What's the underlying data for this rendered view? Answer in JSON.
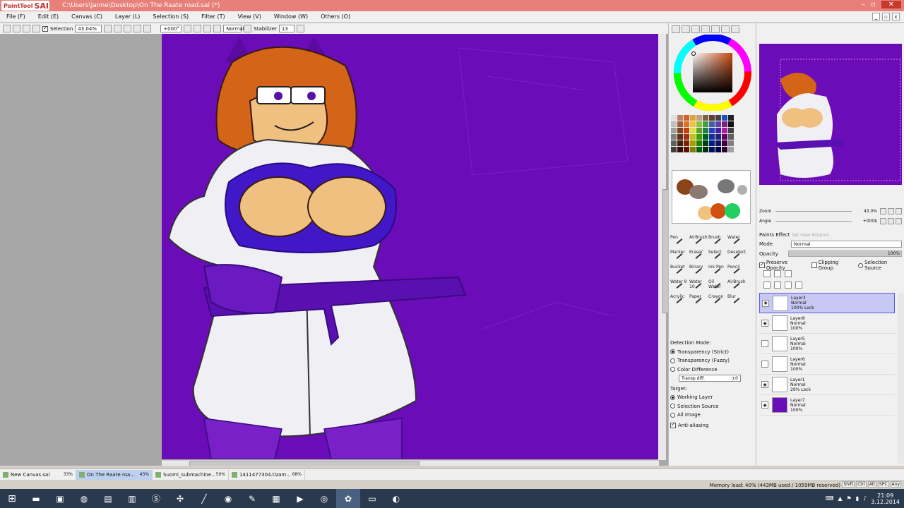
{
  "window": {
    "app_logo": "PaintTool",
    "app_logo_sai": "SAI",
    "title": "C:\\Users\\Janne\\Desktop\\On The Raate road.sai (*)",
    "minimize": "–",
    "maximize": "▫",
    "close": "✕"
  },
  "menu": {
    "items": [
      "File (F)",
      "Edit (E)",
      "Canvas (C)",
      "Layer (L)",
      "Selection (S)",
      "Filter (T)",
      "View (V)",
      "Window (W)",
      "Others (O)"
    ]
  },
  "toolbar": {
    "selection_label": "Selection",
    "zoom": "43.04%",
    "angle": "+000°",
    "blend": "Normal",
    "stabilizer_label": "Stabilizer",
    "stabilizer_value": "13"
  },
  "tools": {
    "rows": [
      [
        "Pen",
        "AirBrush",
        "Brush",
        "Water"
      ],
      [
        "Marker",
        "Eraser",
        "Select",
        "Deselect"
      ],
      [
        "Bucket",
        "Binary",
        "Ink Pen",
        "Pencil"
      ],
      [
        "Water 9",
        "Water 10",
        "Oil Water",
        "AirBrush"
      ],
      [
        "Acrylic",
        "Paper",
        "Crayon",
        "Blur"
      ]
    ]
  },
  "detection": {
    "title": "Detection Mode:",
    "options": [
      "Transparency (Strict)",
      "Transparency (Fuzzy)",
      "Color Difference"
    ],
    "selected": 0,
    "trans_label": "Transp diff.",
    "trans_value": "±0",
    "target_title": "Target:",
    "targets": [
      "Working Layer",
      "Selection Source",
      "All Image"
    ],
    "target_selected": 0,
    "antialias": "Anti-aliasing"
  },
  "navigator": {
    "zoom_label": "Zoom",
    "zoom_value": "43.0%",
    "angle_label": "Angle",
    "angle_value": "+000$",
    "tooltip": "Set View Rotation"
  },
  "layers_panel": {
    "effect_label": "Paints Effect",
    "mode_label": "Mode",
    "mode_value": "Normal",
    "opacity_label": "Opacity",
    "opacity_value": "100%",
    "preserve_opacity": "Preserve Opacity",
    "clipping_group": "Clipping Group",
    "selection_source": "Selection Source",
    "layers": [
      {
        "name": "Layer3",
        "mode": "Normal",
        "opacity": "100% Lock"
      },
      {
        "name": "Layer8",
        "mode": "Normal",
        "opacity": "100%"
      },
      {
        "name": "Layer5",
        "mode": "Normal",
        "opacity": "100%"
      },
      {
        "name": "Layer6",
        "mode": "Normal",
        "opacity": "100%"
      },
      {
        "name": "Layer1",
        "mode": "Normal",
        "opacity": "29% Lock"
      },
      {
        "name": "Layer7",
        "mode": "Normal",
        "opacity": "100%"
      }
    ]
  },
  "tabs": [
    {
      "name": "New Canvas.sai",
      "zoom": "33%"
    },
    {
      "name": "On The Raate roa...",
      "zoom": "43%"
    },
    {
      "name": "Suomi_submachine...",
      "zoom": "50%"
    },
    {
      "name": "1411477304.tizam...",
      "zoom": "68%"
    }
  ],
  "status": {
    "memory": "Memory load: 40% (443MB used / 1059MB reserved)",
    "icons": [
      "Shift",
      "Ctrl",
      "Alt",
      "SPC",
      "Any"
    ]
  },
  "taskbar": {
    "clock_time": "21:09",
    "clock_date": "3.12.2014"
  },
  "colors": {
    "canvas_bg": "#6a0cb8",
    "title_bar": "#e8807a",
    "selected_layer": "#c8c8f4"
  }
}
